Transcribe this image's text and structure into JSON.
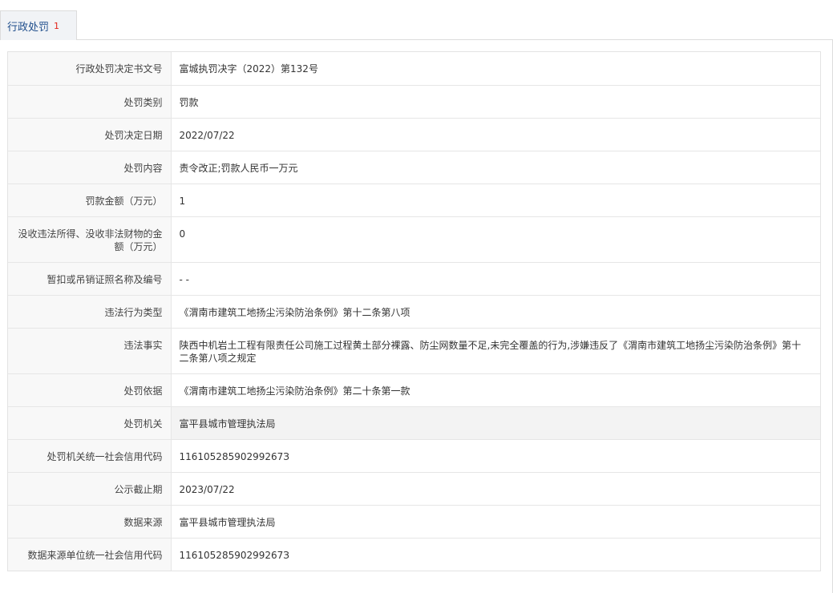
{
  "tab": {
    "label": "行政处罚",
    "count": "1"
  },
  "rows": [
    {
      "label": "行政处罚决定书文号",
      "value": "富城执罚决字（2022）第132号"
    },
    {
      "label": "处罚类别",
      "value": "罚款"
    },
    {
      "label": "处罚决定日期",
      "value": "2022/07/22"
    },
    {
      "label": "处罚内容",
      "value": "责令改正;罚款人民币一万元"
    },
    {
      "label": "罚款金额（万元）",
      "value": "1"
    },
    {
      "label": "没收违法所得、没收非法财物的金额（万元）",
      "value": "0"
    },
    {
      "label": "暂扣或吊销证照名称及编号",
      "value": "- -"
    },
    {
      "label": "违法行为类型",
      "value": "《渭南市建筑工地扬尘污染防治条例》第十二条第八项"
    },
    {
      "label": "违法事实",
      "value": "陕西中机岩土工程有限责任公司施工过程黄土部分裸露、防尘网数量不足,未完全覆盖的行为,涉嫌违反了《渭南市建筑工地扬尘污染防治条例》第十二条第八项之规定"
    },
    {
      "label": "处罚依据",
      "value": "《渭南市建筑工地扬尘污染防治条例》第二十条第一款"
    },
    {
      "label": "处罚机关",
      "value": "富平县城市管理执法局"
    },
    {
      "label": "处罚机关统一社会信用代码",
      "value": "11610528590299267З"
    },
    {
      "label": "公示截止期",
      "value": "2023/07/22"
    },
    {
      "label": "数据来源",
      "value": "富平县城市管理执法局"
    },
    {
      "label": "数据来源单位统一社会信用代码",
      "value": "11610528590299267З"
    }
  ]
}
